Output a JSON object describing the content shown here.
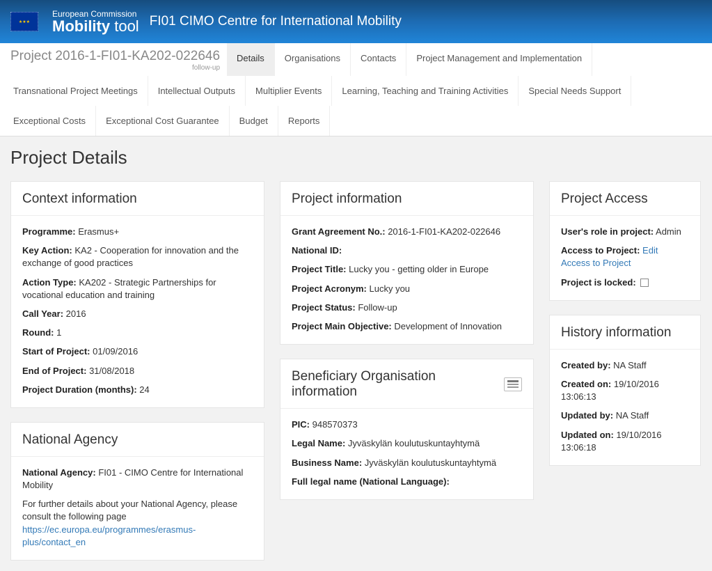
{
  "header": {
    "brand_top": "European Commission",
    "brand_bold": "Mobility",
    "brand_light": " tool",
    "title": "FI01 CIMO Centre for International Mobility"
  },
  "project_code": "Project 2016-1-FI01-KA202-022646",
  "project_code_sub": "follow-up",
  "tabs": [
    "Details",
    "Organisations",
    "Contacts",
    "Project Management and Implementation",
    "Transnational Project Meetings",
    "Intellectual Outputs",
    "Multiplier Events",
    "Learning, Teaching and Training Activities",
    "Special Needs Support",
    "Exceptional Costs",
    "Exceptional Cost Guarantee",
    "Budget",
    "Reports"
  ],
  "page_title": "Project Details",
  "context": {
    "title": "Context information",
    "programme_l": "Programme:",
    "programme_v": " Erasmus+",
    "keyaction_l": "Key Action:",
    "keyaction_v": " KA2 - Cooperation for innovation and the exchange of good practices",
    "actiontype_l": "Action Type:",
    "actiontype_v": " KA202 - Strategic Partnerships for vocational education and training",
    "callyear_l": "Call Year:",
    "callyear_v": " 2016",
    "round_l": "Round:",
    "round_v": " 1",
    "start_l": "Start of Project:",
    "start_v": " 01/09/2016",
    "end_l": "End of Project:",
    "end_v": " 31/08/2018",
    "duration_l": "Project Duration (months):",
    "duration_v": " 24"
  },
  "na": {
    "title": "National Agency",
    "name_l": "National Agency:",
    "name_v": " FI01 - CIMO Centre for International Mobility",
    "further": "For further details about your National Agency, please consult the following page",
    "link": "https://ec.europa.eu/programmes/erasmus-plus/contact_en"
  },
  "pinfo": {
    "title": "Project information",
    "grant_l": "Grant Agreement No.:",
    "grant_v": " 2016-1-FI01-KA202-022646",
    "natid_l": "National ID:",
    "natid_v": "",
    "ptitle_l": "Project Title:",
    "ptitle_v": " Lucky you - getting older in Europe",
    "acronym_l": "Project Acronym:",
    "acronym_v": " Lucky you",
    "status_l": "Project Status:",
    "status_v": " Follow-up",
    "obj_l": "Project Main Objective:",
    "obj_v": " Development of Innovation"
  },
  "ben": {
    "title": "Beneficiary Organisation information",
    "pic_l": "PIC:",
    "pic_v": " 948570373",
    "legal_l": "Legal Name:",
    "legal_v": " Jyväskylän koulutuskuntayhtymä",
    "bus_l": "Business Name:",
    "bus_v": " Jyväskylän koulutuskuntayhtymä",
    "full_l": "Full legal name (National Language):",
    "full_v": ""
  },
  "access": {
    "title": "Project Access",
    "role_l": "User's role in project:",
    "role_v": " Admin",
    "acc_l": "Access to Project:",
    "acc_link": " Edit Access to Project",
    "locked_l": "Project is locked:"
  },
  "history": {
    "title": "History information",
    "cby_l": "Created by:",
    "cby_v": " NA Staff",
    "con_l": "Created on:",
    "con_v": " 19/10/2016 13:06:13",
    "uby_l": "Updated by:",
    "uby_v": " NA Staff",
    "uon_l": "Updated on:",
    "uon_v": " 19/10/2016 13:06:18"
  }
}
